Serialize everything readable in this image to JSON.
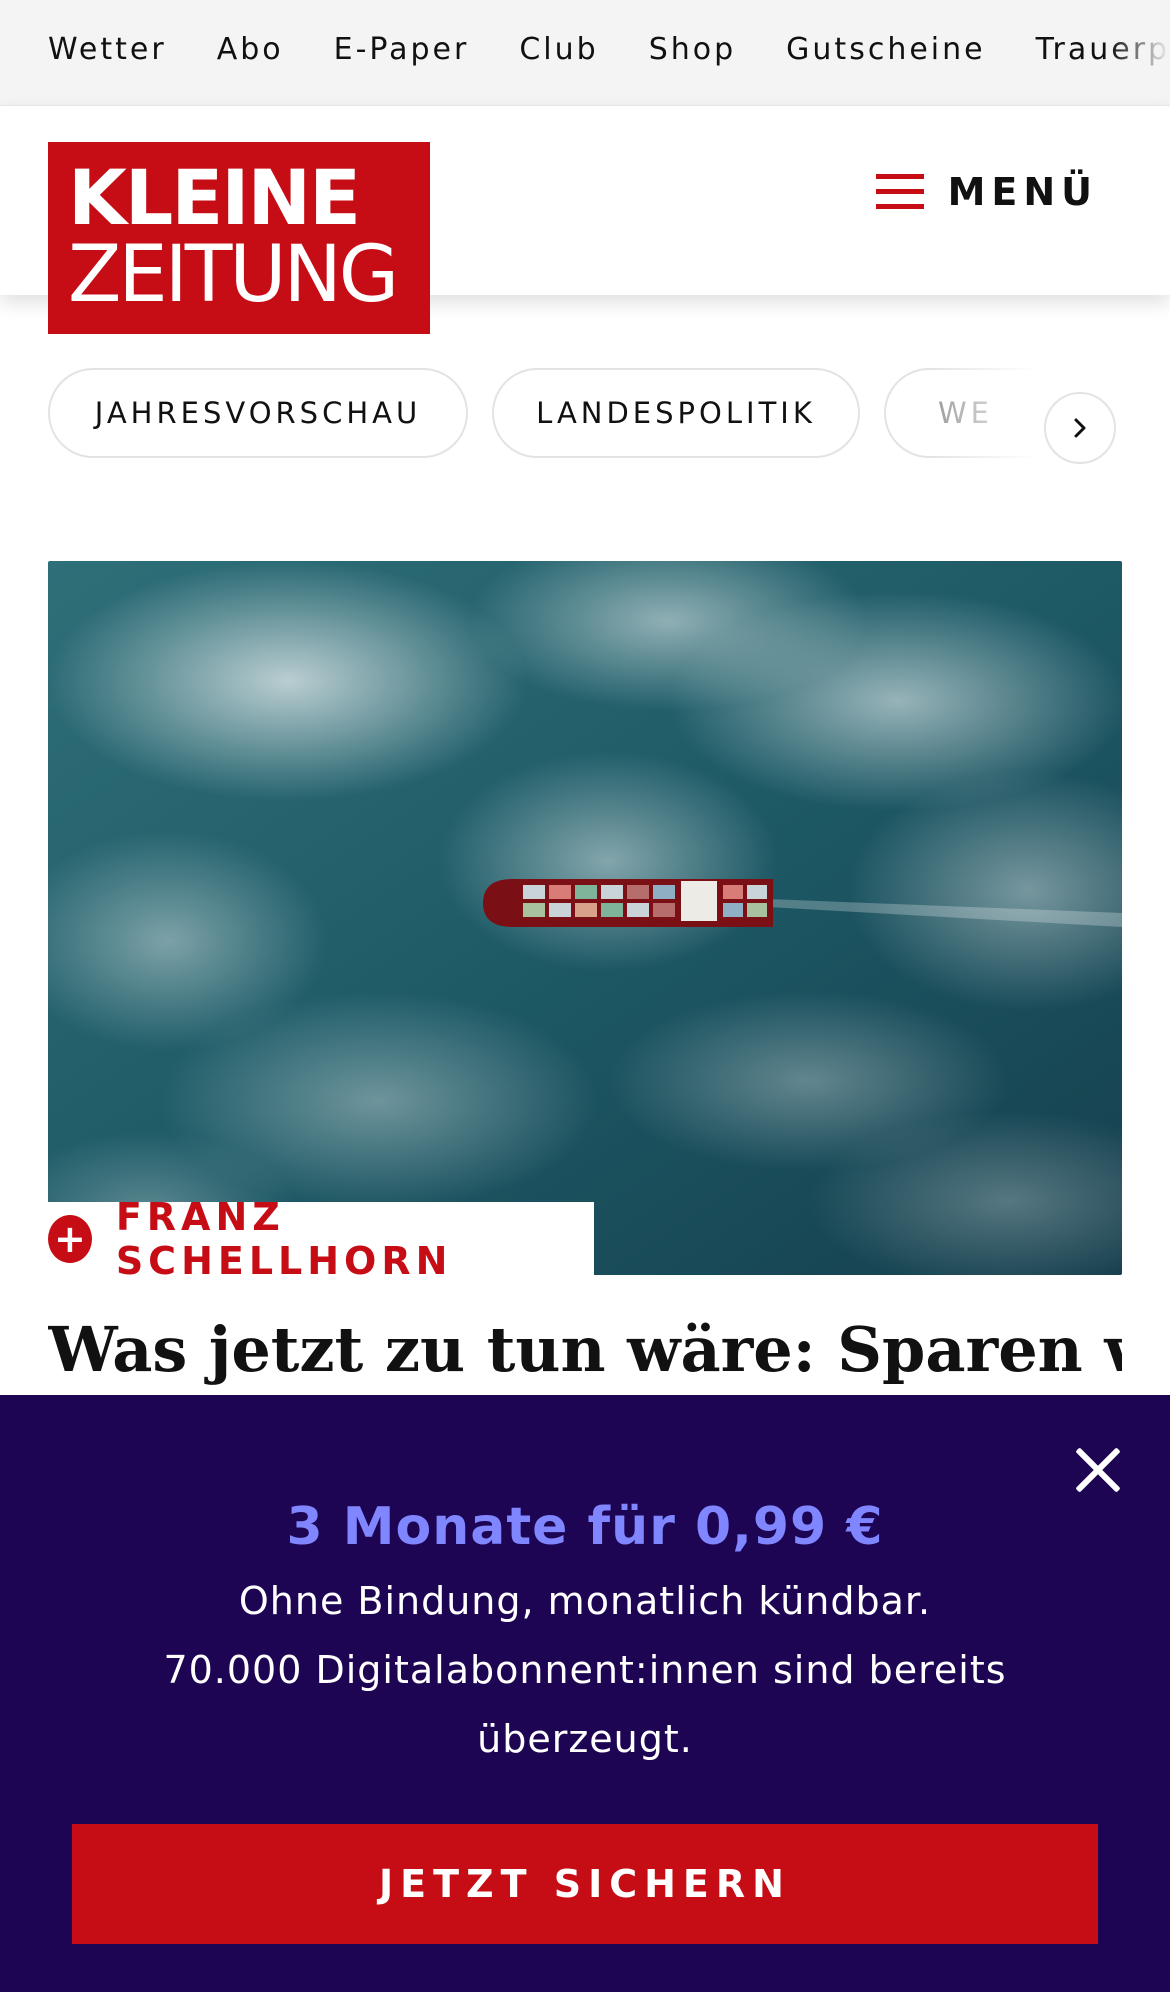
{
  "topnav": {
    "items": [
      "Wetter",
      "Abo",
      "E-Paper",
      "Club",
      "Shop",
      "Gutscheine",
      "Trauerp"
    ]
  },
  "header": {
    "logo_line1": "KLEINE",
    "logo_line2": "ZEITUNG",
    "menu_label": "MENÜ",
    "brand_color": "#c60d16"
  },
  "categories": {
    "items": [
      "JAHRESVORSCHAU",
      "LANDESPOLITIK",
      "WE"
    ],
    "next_icon": "chevron-right-icon"
  },
  "article": {
    "author": "FRANZ SCHELLHORN",
    "headline": "Was jetzt zu tun wäre: Sparen wie"
  },
  "promo": {
    "title": "3 Monate für 0,99 €",
    "line1": "Ohne Bindung, monatlich kündbar.",
    "line2": "70.000 Digitalabonnent:innen sind bereits überzeugt.",
    "cta": "JETZT SICHERN",
    "background": "#1e0553",
    "accent": "#7f86ff"
  }
}
